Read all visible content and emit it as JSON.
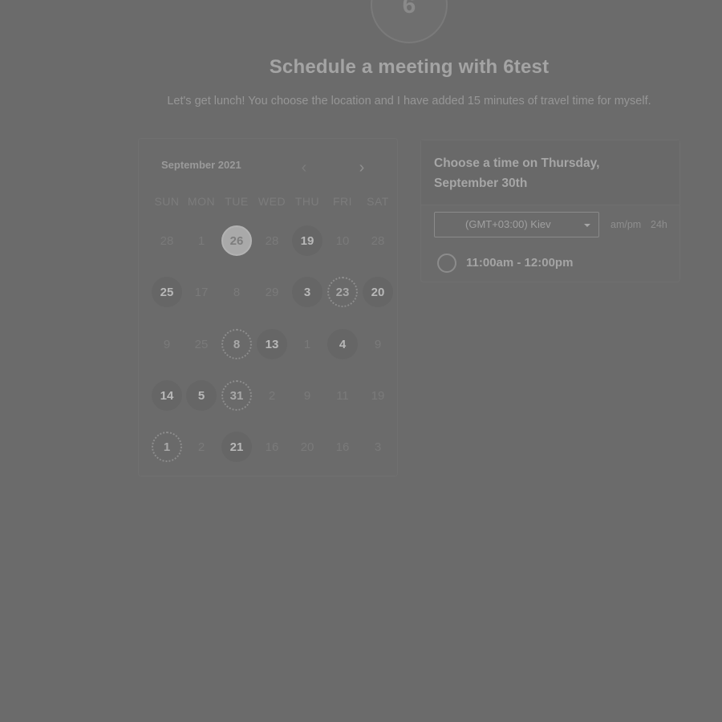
{
  "avatar": {
    "letter": "6"
  },
  "header": {
    "title": "Schedule a meeting with 6test",
    "subtitle": "Let's get lunch! You choose the location and I have added 15 minutes of travel time for myself."
  },
  "calendar": {
    "month_label": "September 2021",
    "prev_icon": "chevron-left-icon",
    "next_icon": "chevron-right-icon",
    "weekdays": [
      "SUN",
      "MON",
      "TUE",
      "WED",
      "THU",
      "FRI",
      "SAT"
    ],
    "weeks": [
      [
        {
          "label": "28",
          "state": "unavailable"
        },
        {
          "label": "1",
          "state": "unavailable"
        },
        {
          "label": "26",
          "state": "selected"
        },
        {
          "label": "28",
          "state": "unavailable"
        },
        {
          "label": "19",
          "state": "available"
        },
        {
          "label": "10",
          "state": "unavailable"
        },
        {
          "label": "28",
          "state": "unavailable"
        }
      ],
      [
        {
          "label": "25",
          "state": "available"
        },
        {
          "label": "17",
          "state": "unavailable"
        },
        {
          "label": "8",
          "state": "unavailable"
        },
        {
          "label": "29",
          "state": "unavailable"
        },
        {
          "label": "3",
          "state": "available"
        },
        {
          "label": "23",
          "state": "today"
        },
        {
          "label": "20",
          "state": "available"
        }
      ],
      [
        {
          "label": "9",
          "state": "unavailable"
        },
        {
          "label": "25",
          "state": "unavailable"
        },
        {
          "label": "8",
          "state": "today"
        },
        {
          "label": "13",
          "state": "available"
        },
        {
          "label": "1",
          "state": "unavailable"
        },
        {
          "label": "4",
          "state": "available"
        },
        {
          "label": "9",
          "state": "unavailable"
        }
      ],
      [
        {
          "label": "14",
          "state": "available"
        },
        {
          "label": "5",
          "state": "available"
        },
        {
          "label": "31",
          "state": "today"
        },
        {
          "label": "2",
          "state": "unavailable"
        },
        {
          "label": "9",
          "state": "unavailable"
        },
        {
          "label": "11",
          "state": "unavailable"
        },
        {
          "label": "19",
          "state": "unavailable"
        }
      ],
      [
        {
          "label": "1",
          "state": "today"
        },
        {
          "label": "2",
          "state": "unavailable"
        },
        {
          "label": "21",
          "state": "available"
        },
        {
          "label": "16",
          "state": "unavailable"
        },
        {
          "label": "20",
          "state": "unavailable"
        },
        {
          "label": "16",
          "state": "unavailable"
        },
        {
          "label": "3",
          "state": "unavailable"
        }
      ]
    ]
  },
  "time_panel": {
    "title": "Choose a time on Thursday, September 30th",
    "timezone": "(GMT+03:00) Kiev",
    "format_ampm": "am/pm",
    "format_24h": "24h",
    "slots": [
      {
        "label": "11:00am - 12:00pm"
      }
    ]
  }
}
